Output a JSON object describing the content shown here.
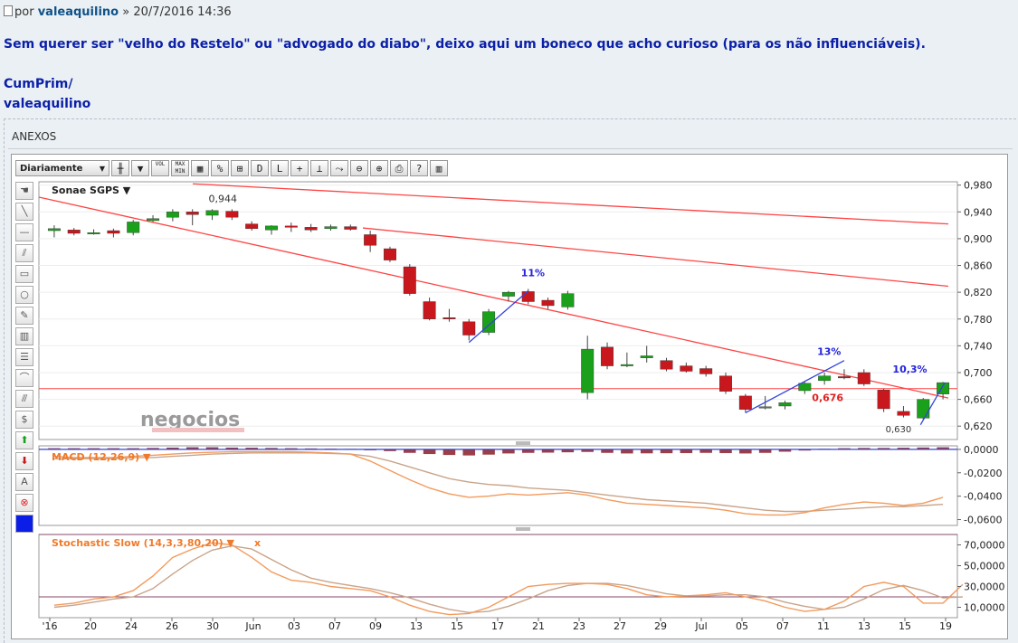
{
  "post": {
    "prefix": "por",
    "author": "valeaquilino",
    "separator": "»",
    "datetime": "20/7/2016 14:36",
    "body": "Sem querer ser \"velho do Restelo\" ou \"advogado do diabo\", deixo aqui um boneco que acho curioso (para os não influenciáveis).",
    "signature": [
      "CumPrim/",
      "valeaquilino"
    ]
  },
  "attachments": {
    "label": "ANEXOS"
  },
  "chart": {
    "toolbar": {
      "period": "Diariamente",
      "buttons": [
        "candles-icon",
        "▼",
        "VOL",
        "MAX MIN",
        "grid-icon",
        "%",
        "compare-icon",
        "D",
        "L",
        "+",
        "crosshair-icon",
        "zoom-fit-icon",
        "zoom-out-icon",
        "zoom-in-icon",
        "print-icon",
        "?",
        "book-icon"
      ]
    },
    "side_tools": [
      "hand-icon",
      "line-icon",
      "hline-icon",
      "channel-icon",
      "rect-icon",
      "circle-icon",
      "pen-icon",
      "fibo-icon",
      "grid2-icon",
      "arc-icon",
      "parallel-icon",
      "dollar-icon",
      "up-arrow-icon",
      "down-arrow-icon",
      "A",
      "delete-icon",
      "color-icon"
    ],
    "watermark": "negocios",
    "symbol": "Sonae SGPS ▼",
    "macd_label": "MACD (12,26,9) ▼",
    "stoch_label": "Stochastic Slow (14,3,3,80,20) ▼",
    "stoch_close": "x",
    "colors": {
      "up": "#1aa01a",
      "down": "#c8171d",
      "trend": "#ff4444",
      "annot": "#2222dd",
      "macd_line": "#f39a5c",
      "signal_line": "#c9a48a",
      "stoch_k": "#f39a5c",
      "stoch_d": "#c9a48a"
    }
  },
  "chart_data": {
    "type": "candlestick",
    "price_axis": {
      "ticks": [
        "0,980",
        "0,940",
        "0,900",
        "0,860",
        "0,820",
        "0,780",
        "0,740",
        "0,700",
        "0,660",
        "0,620"
      ],
      "range": [
        0.6,
        0.985
      ]
    },
    "macd_axis": {
      "ticks": [
        "0,0000",
        "-0,0200",
        "-0,0400",
        "-0,0600"
      ],
      "range": [
        -0.065,
        0.003
      ]
    },
    "stoch_axis": {
      "ticks": [
        "70,0000",
        "50,0000",
        "30,0000",
        "10,0000"
      ],
      "range": [
        0,
        80
      ]
    },
    "x_labels": [
      "'16",
      "20",
      "24",
      "26",
      "30",
      "Jun",
      "03",
      "07",
      "09",
      "13",
      "15",
      "17",
      "21",
      "23",
      "27",
      "29",
      "Jul",
      "05",
      "07",
      "11",
      "13",
      "15",
      "19"
    ],
    "candles": [
      {
        "o": 0.912,
        "h": 0.92,
        "l": 0.902,
        "c": 0.915
      },
      {
        "o": 0.913,
        "h": 0.916,
        "l": 0.905,
        "c": 0.908
      },
      {
        "o": 0.908,
        "h": 0.914,
        "l": 0.906,
        "c": 0.909
      },
      {
        "o": 0.912,
        "h": 0.915,
        "l": 0.902,
        "c": 0.908
      },
      {
        "o": 0.909,
        "h": 0.928,
        "l": 0.905,
        "c": 0.925
      },
      {
        "o": 0.927,
        "h": 0.935,
        "l": 0.925,
        "c": 0.93
      },
      {
        "o": 0.932,
        "h": 0.944,
        "l": 0.926,
        "c": 0.94
      },
      {
        "o": 0.94,
        "h": 0.944,
        "l": 0.92,
        "c": 0.936
      },
      {
        "o": 0.935,
        "h": 0.944,
        "l": 0.928,
        "c": 0.942
      },
      {
        "o": 0.941,
        "h": 0.944,
        "l": 0.928,
        "c": 0.932
      },
      {
        "o": 0.922,
        "h": 0.926,
        "l": 0.912,
        "c": 0.915
      },
      {
        "o": 0.913,
        "h": 0.92,
        "l": 0.906,
        "c": 0.919
      },
      {
        "o": 0.919,
        "h": 0.924,
        "l": 0.91,
        "c": 0.917
      },
      {
        "o": 0.917,
        "h": 0.922,
        "l": 0.91,
        "c": 0.913
      },
      {
        "o": 0.915,
        "h": 0.921,
        "l": 0.912,
        "c": 0.918
      },
      {
        "o": 0.918,
        "h": 0.921,
        "l": 0.912,
        "c": 0.914
      },
      {
        "o": 0.906,
        "h": 0.912,
        "l": 0.88,
        "c": 0.89
      },
      {
        "o": 0.885,
        "h": 0.888,
        "l": 0.865,
        "c": 0.868
      },
      {
        "o": 0.858,
        "h": 0.862,
        "l": 0.815,
        "c": 0.818
      },
      {
        "o": 0.806,
        "h": 0.812,
        "l": 0.778,
        "c": 0.78
      },
      {
        "o": 0.782,
        "h": 0.795,
        "l": 0.776,
        "c": 0.78
      },
      {
        "o": 0.776,
        "h": 0.78,
        "l": 0.748,
        "c": 0.756
      },
      {
        "o": 0.76,
        "h": 0.795,
        "l": 0.756,
        "c": 0.791
      },
      {
        "o": 0.814,
        "h": 0.822,
        "l": 0.806,
        "c": 0.82
      },
      {
        "o": 0.821,
        "h": 0.825,
        "l": 0.802,
        "c": 0.806
      },
      {
        "o": 0.808,
        "h": 0.812,
        "l": 0.795,
        "c": 0.8
      },
      {
        "o": 0.798,
        "h": 0.822,
        "l": 0.794,
        "c": 0.818
      },
      {
        "o": 0.67,
        "h": 0.755,
        "l": 0.66,
        "c": 0.735
      },
      {
        "o": 0.738,
        "h": 0.745,
        "l": 0.705,
        "c": 0.71
      },
      {
        "o": 0.712,
        "h": 0.73,
        "l": 0.708,
        "c": 0.712
      },
      {
        "o": 0.722,
        "h": 0.74,
        "l": 0.715,
        "c": 0.725
      },
      {
        "o": 0.718,
        "h": 0.722,
        "l": 0.702,
        "c": 0.705
      },
      {
        "o": 0.71,
        "h": 0.715,
        "l": 0.7,
        "c": 0.702
      },
      {
        "o": 0.706,
        "h": 0.71,
        "l": 0.694,
        "c": 0.698
      },
      {
        "o": 0.695,
        "h": 0.7,
        "l": 0.668,
        "c": 0.672
      },
      {
        "o": 0.665,
        "h": 0.668,
        "l": 0.64,
        "c": 0.645
      },
      {
        "o": 0.648,
        "h": 0.665,
        "l": 0.645,
        "c": 0.649
      },
      {
        "o": 0.65,
        "h": 0.658,
        "l": 0.645,
        "c": 0.655
      },
      {
        "o": 0.673,
        "h": 0.686,
        "l": 0.668,
        "c": 0.684
      },
      {
        "o": 0.688,
        "h": 0.7,
        "l": 0.682,
        "c": 0.695
      },
      {
        "o": 0.694,
        "h": 0.705,
        "l": 0.69,
        "c": 0.693
      },
      {
        "o": 0.7,
        "h": 0.705,
        "l": 0.68,
        "c": 0.683
      },
      {
        "o": 0.674,
        "h": 0.676,
        "l": 0.641,
        "c": 0.646
      },
      {
        "o": 0.642,
        "h": 0.65,
        "l": 0.633,
        "c": 0.636
      },
      {
        "o": 0.632,
        "h": 0.662,
        "l": 0.63,
        "c": 0.66
      },
      {
        "o": 0.668,
        "h": 0.686,
        "l": 0.66,
        "c": 0.685
      }
    ],
    "annotations": [
      {
        "text": "0,944",
        "color": "dark"
      },
      {
        "text": "11%",
        "color": "blue"
      },
      {
        "text": "13%",
        "color": "blue"
      },
      {
        "text": "10,3%",
        "color": "blue"
      },
      {
        "text": "0,676",
        "color": "red"
      },
      {
        "text": "0,630",
        "color": "dark"
      }
    ],
    "macd_hist": [
      0.001,
      0.001,
      0.001,
      0.001,
      0.001,
      0.0012,
      0.0015,
      0.0018,
      0.0018,
      0.0015,
      0.0014,
      0.0012,
      0.001,
      0.0008,
      0.0006,
      0.0004,
      -0.0005,
      -0.0015,
      -0.003,
      -0.004,
      -0.0048,
      -0.0052,
      -0.0045,
      -0.0035,
      -0.003,
      -0.0028,
      -0.0025,
      -0.0022,
      -0.003,
      -0.0035,
      -0.0034,
      -0.0033,
      -0.0032,
      -0.003,
      -0.0032,
      -0.0035,
      -0.003,
      -0.002,
      -0.001,
      0.0005,
      0.001,
      0.0012,
      0.0012,
      0.0014,
      0.0016,
      0.0018
    ],
    "macd_line": [
      -0.006,
      -0.007,
      -0.007,
      -0.007,
      -0.006,
      -0.005,
      -0.004,
      -0.003,
      -0.0025,
      -0.002,
      -0.002,
      -0.002,
      -0.002,
      -0.0025,
      -0.003,
      -0.004,
      -0.01,
      -0.018,
      -0.026,
      -0.033,
      -0.038,
      -0.041,
      -0.04,
      -0.038,
      -0.039,
      -0.038,
      -0.037,
      -0.039,
      -0.043,
      -0.046,
      -0.047,
      -0.048,
      -0.049,
      -0.05,
      -0.052,
      -0.055,
      -0.056,
      -0.056,
      -0.054,
      -0.05,
      -0.047,
      -0.045,
      -0.046,
      -0.048,
      -0.046,
      -0.041
    ],
    "signal_line": [
      -0.008,
      -0.008,
      -0.008,
      -0.008,
      -0.007,
      -0.007,
      -0.006,
      -0.005,
      -0.004,
      -0.0035,
      -0.003,
      -0.003,
      -0.003,
      -0.003,
      -0.0035,
      -0.004,
      -0.006,
      -0.01,
      -0.015,
      -0.02,
      -0.025,
      -0.028,
      -0.03,
      -0.031,
      -0.033,
      -0.034,
      -0.035,
      -0.037,
      -0.039,
      -0.041,
      -0.043,
      -0.044,
      -0.045,
      -0.046,
      -0.048,
      -0.05,
      -0.052,
      -0.053,
      -0.053,
      -0.052,
      -0.051,
      -0.05,
      -0.049,
      -0.049,
      -0.048,
      -0.047
    ],
    "stoch_k": [
      12,
      14,
      18,
      20,
      26,
      40,
      58,
      66,
      72,
      70,
      58,
      44,
      36,
      34,
      30,
      28,
      26,
      20,
      12,
      6,
      3,
      4,
      10,
      20,
      30,
      32,
      33,
      33,
      32,
      28,
      22,
      20,
      21,
      22,
      24,
      20,
      16,
      10,
      6,
      8,
      16,
      30,
      34,
      30,
      14,
      14,
      32
    ],
    "stoch_d": [
      10,
      12,
      15,
      18,
      20,
      28,
      42,
      55,
      65,
      69,
      66,
      56,
      46,
      38,
      34,
      31,
      28,
      24,
      19,
      13,
      8,
      5,
      6,
      11,
      18,
      26,
      31,
      33,
      33,
      31,
      27,
      23,
      21,
      21,
      22,
      22,
      20,
      15,
      11,
      8,
      10,
      18,
      27,
      31,
      26,
      19,
      20
    ],
    "stoch_levels": [
      80,
      20
    ]
  }
}
